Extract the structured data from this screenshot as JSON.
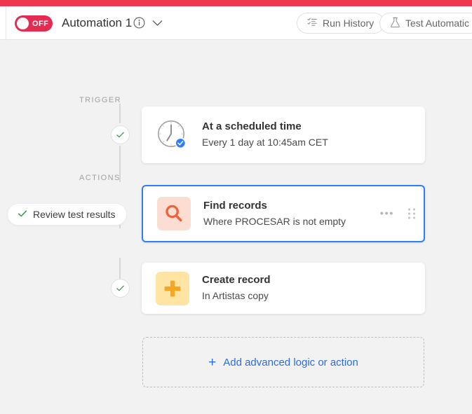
{
  "window": {
    "accent_color": "#ed3751",
    "canvas_background": "#f2f2f2"
  },
  "header": {
    "toggle": {
      "state_label": "OFF",
      "enabled": false,
      "color": "#e32c52"
    },
    "title": "Automation 1",
    "info_icon": "info-circle-icon",
    "chevron_icon": "chevron-down-icon",
    "buttons": [
      {
        "label": "Run History",
        "icon": "run-history-icon"
      },
      {
        "label": "Test Automatic",
        "icon": "flask-icon"
      }
    ]
  },
  "flow": {
    "sections": {
      "trigger_label": "TRIGGER",
      "actions_label": "ACTIONS"
    },
    "review_badge": {
      "label": "Review test results",
      "icon": "check-icon",
      "icon_color": "#3a9a4b"
    },
    "steps": [
      {
        "kind": "trigger",
        "title": "At a scheduled time",
        "subtitle": "Every 1 day at 10:45am CET",
        "icon": "clock-icon",
        "icon_badge": "check-badge-icon",
        "status": "configured",
        "selected": false
      },
      {
        "kind": "action",
        "title": "Find records",
        "subtitle": "Where PROCESAR is not empty",
        "icon": "magnifier-icon",
        "icon_tile_color": "#fcddd2",
        "icon_color": "#f0613c",
        "selected": true,
        "selection_color": "#2d7ff9",
        "more_icon": "ellipsis-icon",
        "drag_icon": "drag-handle-icon"
      },
      {
        "kind": "action",
        "title": "Create record",
        "subtitle": "In Artistas copy",
        "icon": "plus-icon",
        "icon_tile_color": "#ffe4a3",
        "icon_color": "#f5a623",
        "status": "configured",
        "selected": false
      }
    ],
    "add_action": {
      "label": "Add advanced logic or action",
      "icon": "plus-icon",
      "color": "#2d6ce0"
    }
  }
}
